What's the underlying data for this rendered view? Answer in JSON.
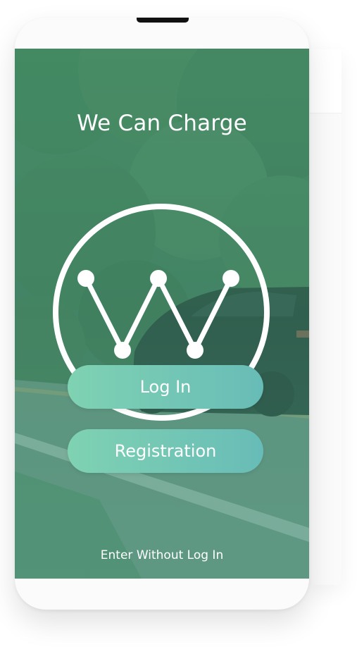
{
  "app": {
    "title": "We Can Charge"
  },
  "actions": {
    "login_label": "Log In",
    "register_label": "Registration",
    "skip_label": "Enter Without Log In"
  },
  "logo": {
    "icon": "w-logo-icon"
  },
  "colors": {
    "button_start": "#7fd2b2",
    "button_end": "#68bcb7",
    "tint": "#4f8a74",
    "text": "#ffffff"
  }
}
